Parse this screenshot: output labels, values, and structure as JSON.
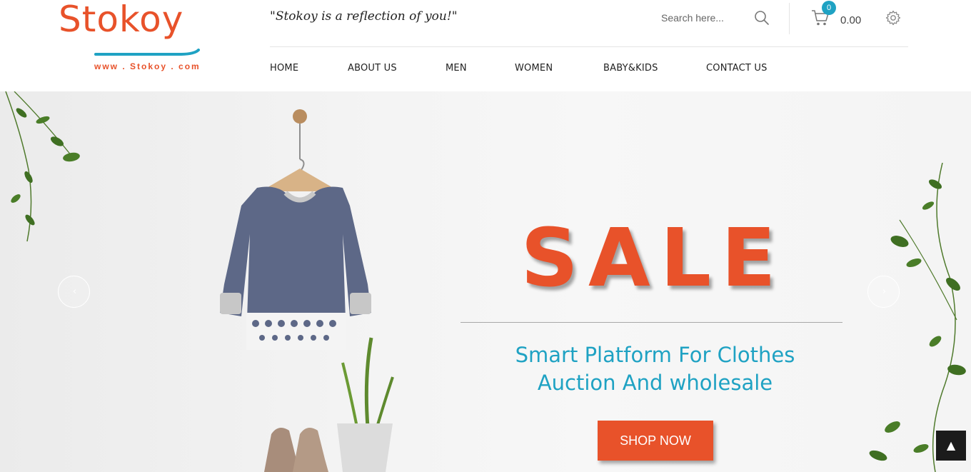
{
  "brand": {
    "logo_text": "Stokoy",
    "logo_url_text": "www . Stokoy . com",
    "tagline": "\"Stokoy is a reflection of you!\""
  },
  "search": {
    "placeholder": "Search here...",
    "icon": "search-icon"
  },
  "cart": {
    "count": "0",
    "total": "0.00",
    "icon": "cart-icon"
  },
  "settings": {
    "icon": "gear-icon"
  },
  "nav": {
    "items": [
      {
        "label": "HOME"
      },
      {
        "label": "ABOUT US"
      },
      {
        "label": "MEN"
      },
      {
        "label": "WOMEN"
      },
      {
        "label": "BABY&KIDS"
      },
      {
        "label": "CONTACT US"
      }
    ]
  },
  "hero": {
    "headline": "SALE",
    "subtitle_line1": "Smart Platform For Clothes",
    "subtitle_line2": "Auction And wholesale",
    "cta_label": "SHOP NOW",
    "prev_icon": "chevron-left-icon",
    "next_icon": "chevron-right-icon",
    "prev_glyph": "‹",
    "next_glyph": "›"
  },
  "scroll_top": {
    "glyph": "▲",
    "icon": "arrow-up-icon"
  },
  "colors": {
    "brand_orange": "#e8522a",
    "accent_teal": "#1fa2c3",
    "dark": "#1b1b1b"
  }
}
